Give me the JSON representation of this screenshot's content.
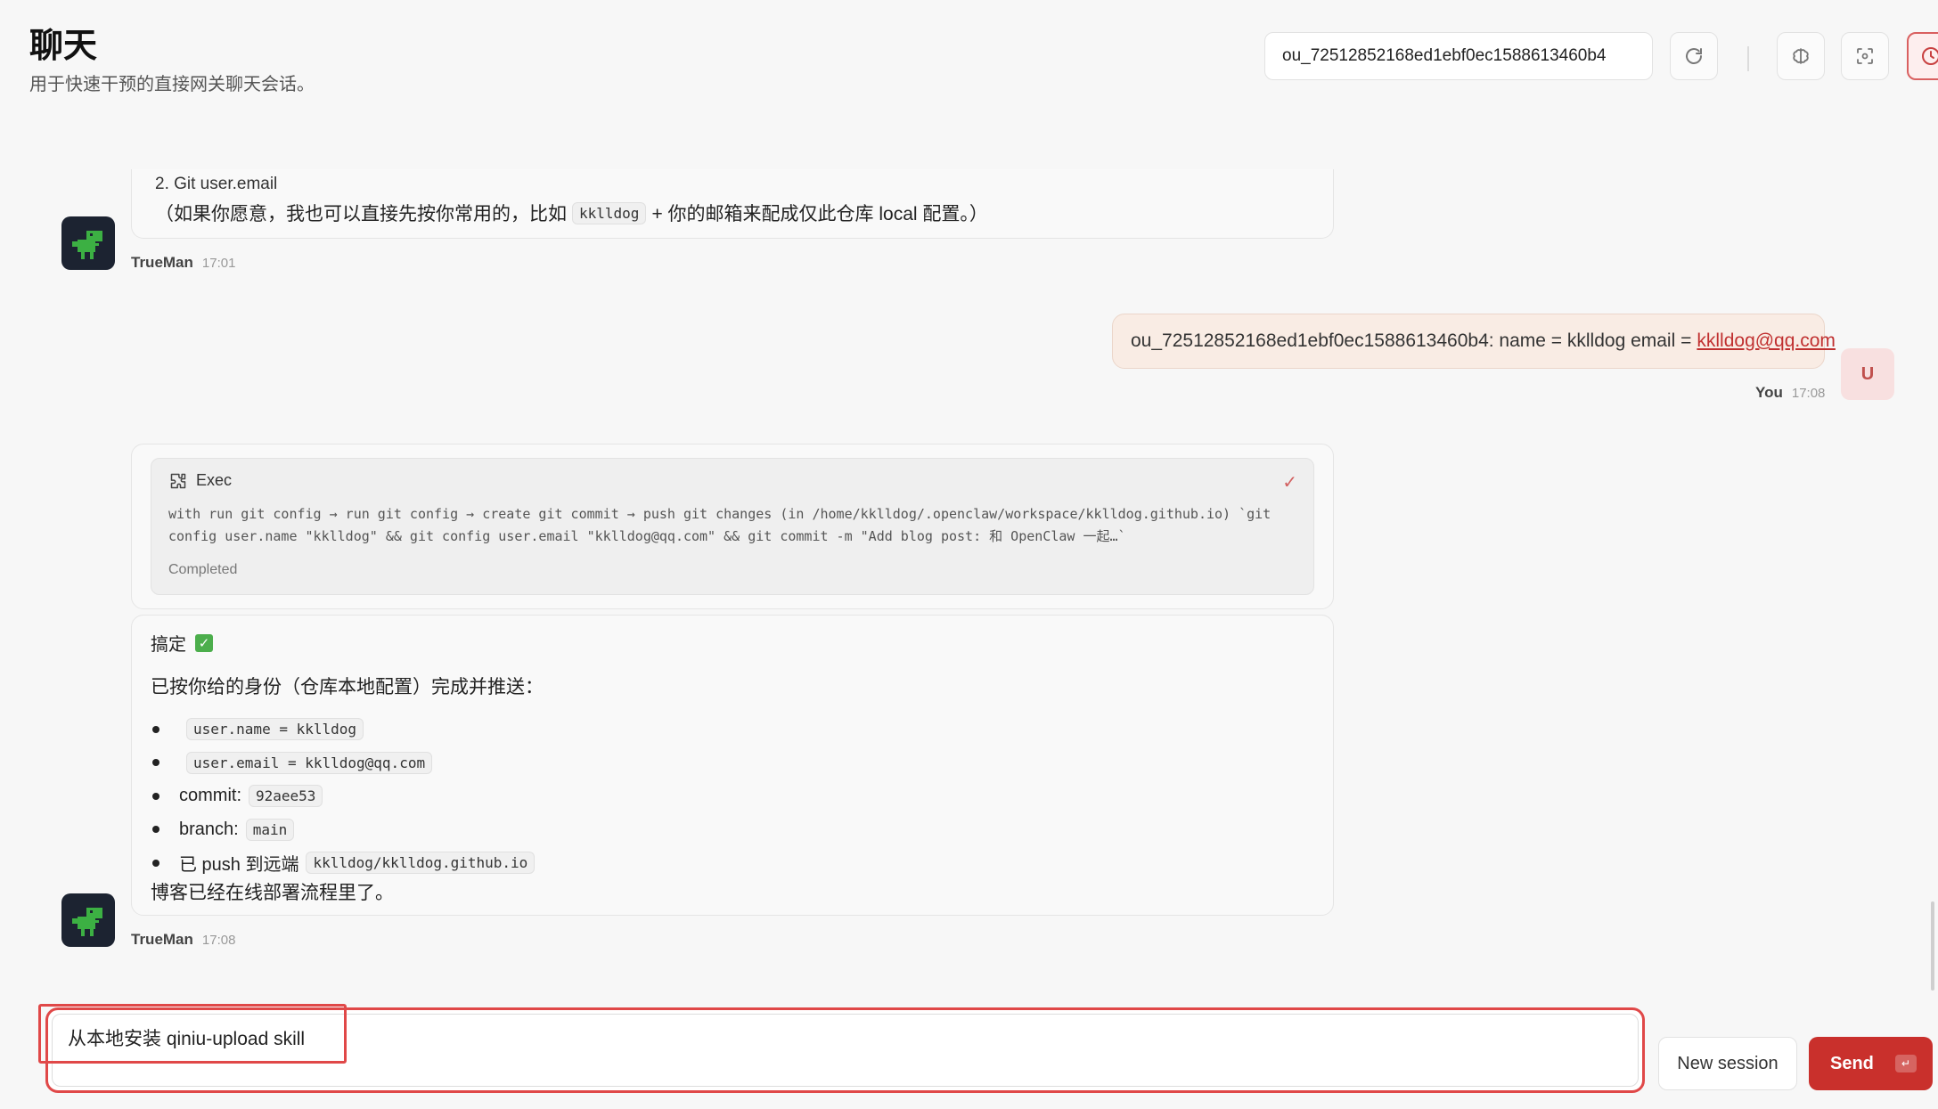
{
  "header": {
    "title": "聊天",
    "subtitle": "用于快速干预的直接网关聊天会话。",
    "session_key": "ou_72512852168ed1ebf0ec1588613460b4"
  },
  "messages": {
    "assistant1": {
      "line1": "2. Git user.email",
      "line2_before": "（如果你愿意，我也可以直接先按你常用的，比如",
      "line2_code": "kklldog",
      "line2_after": "+ 你的邮箱来配成仅此仓库 local 配置。）",
      "sender": "TrueMan",
      "time": "17:01"
    },
    "user1": {
      "text": "ou_72512852168ed1ebf0ec1588613460b4: name = kklldog email =",
      "link": "kklldog@qq.com",
      "sender": "You",
      "time": "17:08",
      "avatar_letter": "U"
    },
    "exec": {
      "label": "Exec",
      "command": "with run git config → run git config → create git commit → push git changes (in /home/kklldog/.openclaw/workspace/kklldog.github.io) `git config user.name \"kklldog\" && git config user.email \"kklldog@qq.com\" && git commit -m \"Add blog post: 和 OpenClaw 一起…`",
      "status": "Completed"
    },
    "assistant2": {
      "title": "搞定",
      "subtitle": "已按你给的身份（仓库本地配置）完成并推送：",
      "items": [
        {
          "prefix": "",
          "code": "user.name = kklldog"
        },
        {
          "prefix": "",
          "code": "user.email = kklldog@qq.com"
        },
        {
          "prefix": "commit:",
          "code": "92aee53"
        },
        {
          "prefix": "branch:",
          "code": "main"
        },
        {
          "prefix": "已 push 到远端",
          "code": "kklldog/kklldog.github.io"
        }
      ],
      "footer": "博客已经在线部署流程里了。",
      "sender": "TrueMan",
      "time": "17:08"
    }
  },
  "composer": {
    "value": "从本地安装 qiniu-upload skill",
    "new_session_label": "New session",
    "send_label": "Send",
    "send_key": "↵"
  },
  "colors": {
    "accent": "#c9302c",
    "highlight": "#e04848",
    "user_bubble": "#f9ece4"
  },
  "icons": [
    "refresh-icon",
    "brain-icon",
    "focus-icon",
    "clock-icon",
    "puzzle-icon",
    "check-icon",
    "dino-avatar-icon"
  ]
}
